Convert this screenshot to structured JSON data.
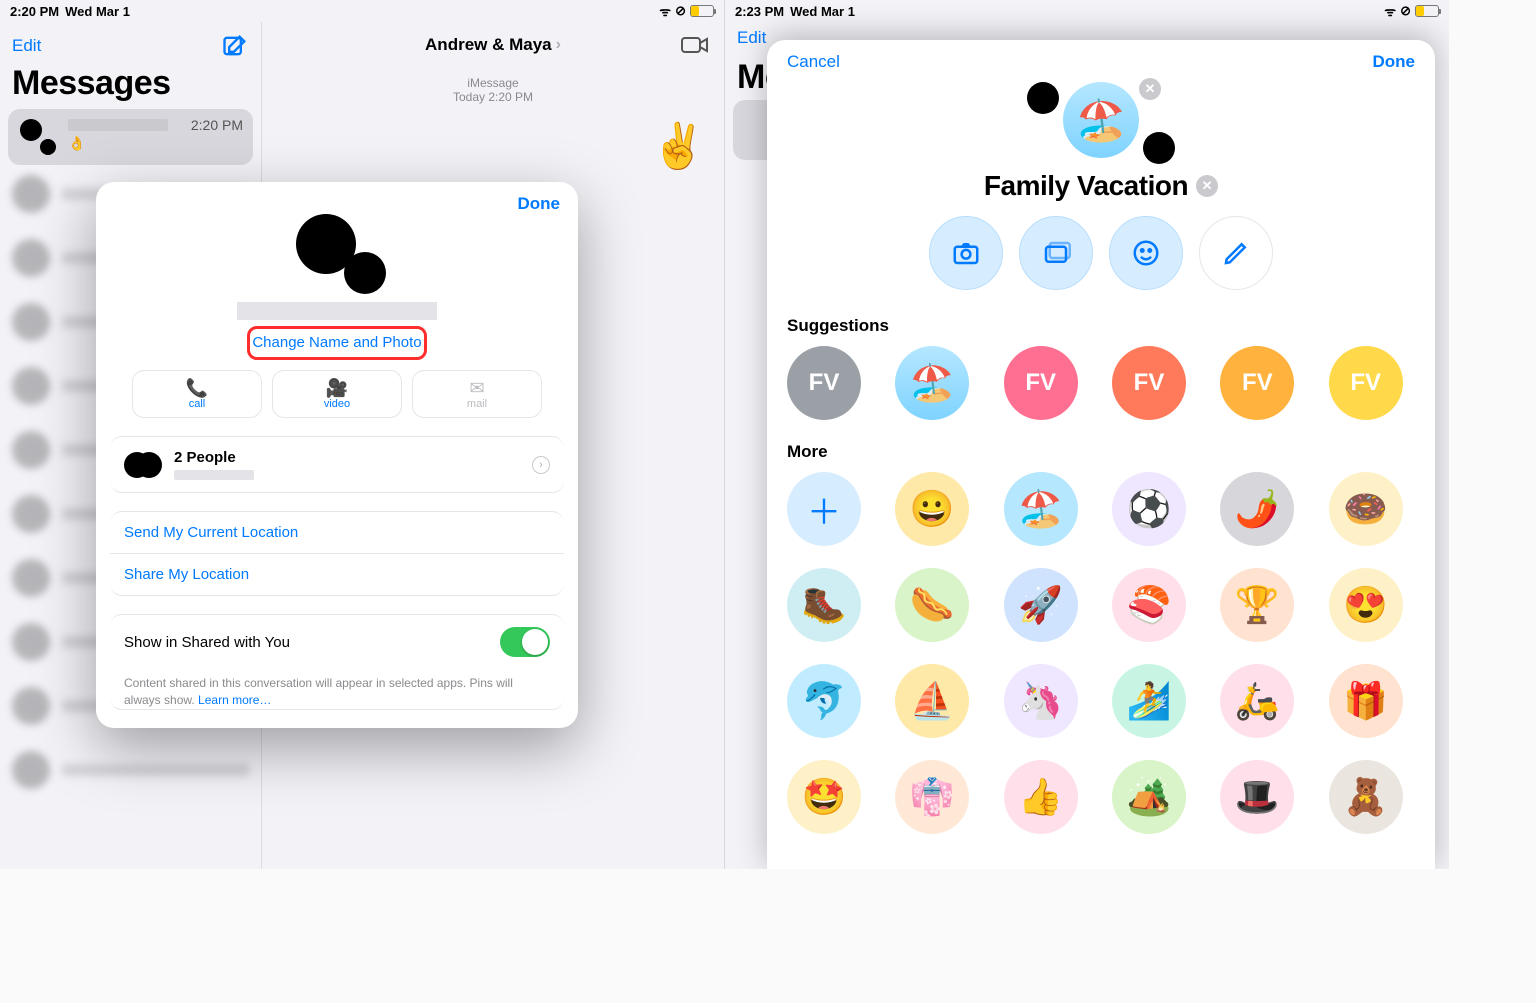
{
  "status": {
    "time_left": "2:20 PM",
    "time_right": "2:23 PM",
    "date": "Wed Mar 1"
  },
  "sidebar": {
    "edit": "Edit",
    "title": "Messages",
    "time": "2:20 PM",
    "emoji": "👌"
  },
  "chat": {
    "title": "Andrew & Maya",
    "meta_line1": "iMessage",
    "meta_line2": "Today 2:20 PM",
    "reaction": "✌️"
  },
  "modal": {
    "done": "Done",
    "change": "Change Name and Photo",
    "actions": {
      "call": "call",
      "video": "video",
      "mail": "mail"
    },
    "people": "2 People",
    "send_loc": "Send My Current Location",
    "share_loc": "Share My Location",
    "shared": "Show in Shared with You",
    "footnote": "Content shared in this conversation will appear in selected apps. Pins will always show. ",
    "learn": "Learn more…"
  },
  "sheet": {
    "cancel": "Cancel",
    "done": "Done",
    "title": "Family Vacation",
    "icon_emoji": "🏖️",
    "suggestions_h": "Suggestions",
    "more_h": "More",
    "initials": "FV",
    "sugg_colors": [
      "#9ba0a6",
      "#7fd3ff",
      "#ff6f92",
      "#ff7a5a",
      "#ffb23d",
      "#ffd94a"
    ],
    "more": [
      {
        "bg": "#d6ecff",
        "emoji": "",
        "plus": true
      },
      {
        "bg": "#ffe9a8",
        "emoji": "😀"
      },
      {
        "bg": "#b5e7ff",
        "emoji": "🏖️"
      },
      {
        "bg": "#efe6ff",
        "emoji": "⚽"
      },
      {
        "bg": "#d7d7db",
        "emoji": "🌶️"
      },
      {
        "bg": "#fff1c7",
        "emoji": "🍩"
      },
      {
        "bg": "#cfeef3",
        "emoji": "🥾"
      },
      {
        "bg": "#d8f4c8",
        "emoji": "🌭"
      },
      {
        "bg": "#cfe3ff",
        "emoji": "🚀"
      },
      {
        "bg": "#ffe0ea",
        "emoji": "🍣"
      },
      {
        "bg": "#ffe2cf",
        "emoji": "🏆"
      },
      {
        "bg": "#fff1c7",
        "emoji": "😍"
      },
      {
        "bg": "#c1ecff",
        "emoji": "🐬"
      },
      {
        "bg": "#ffe9a8",
        "emoji": "⛵"
      },
      {
        "bg": "#efe6ff",
        "emoji": "🦄"
      },
      {
        "bg": "#c8f5e3",
        "emoji": "🏄"
      },
      {
        "bg": "#ffe0ea",
        "emoji": "🛵"
      },
      {
        "bg": "#ffe2cf",
        "emoji": "🎁"
      },
      {
        "bg": "#fff1c7",
        "emoji": "🤩"
      },
      {
        "bg": "#ffe9d6",
        "emoji": "👘"
      },
      {
        "bg": "#ffe0ea",
        "emoji": "👍"
      },
      {
        "bg": "#d8f4c8",
        "emoji": "🏕️"
      },
      {
        "bg": "#ffe0ea",
        "emoji": "🎩"
      },
      {
        "bg": "#eae6df",
        "emoji": "🧸"
      }
    ]
  }
}
